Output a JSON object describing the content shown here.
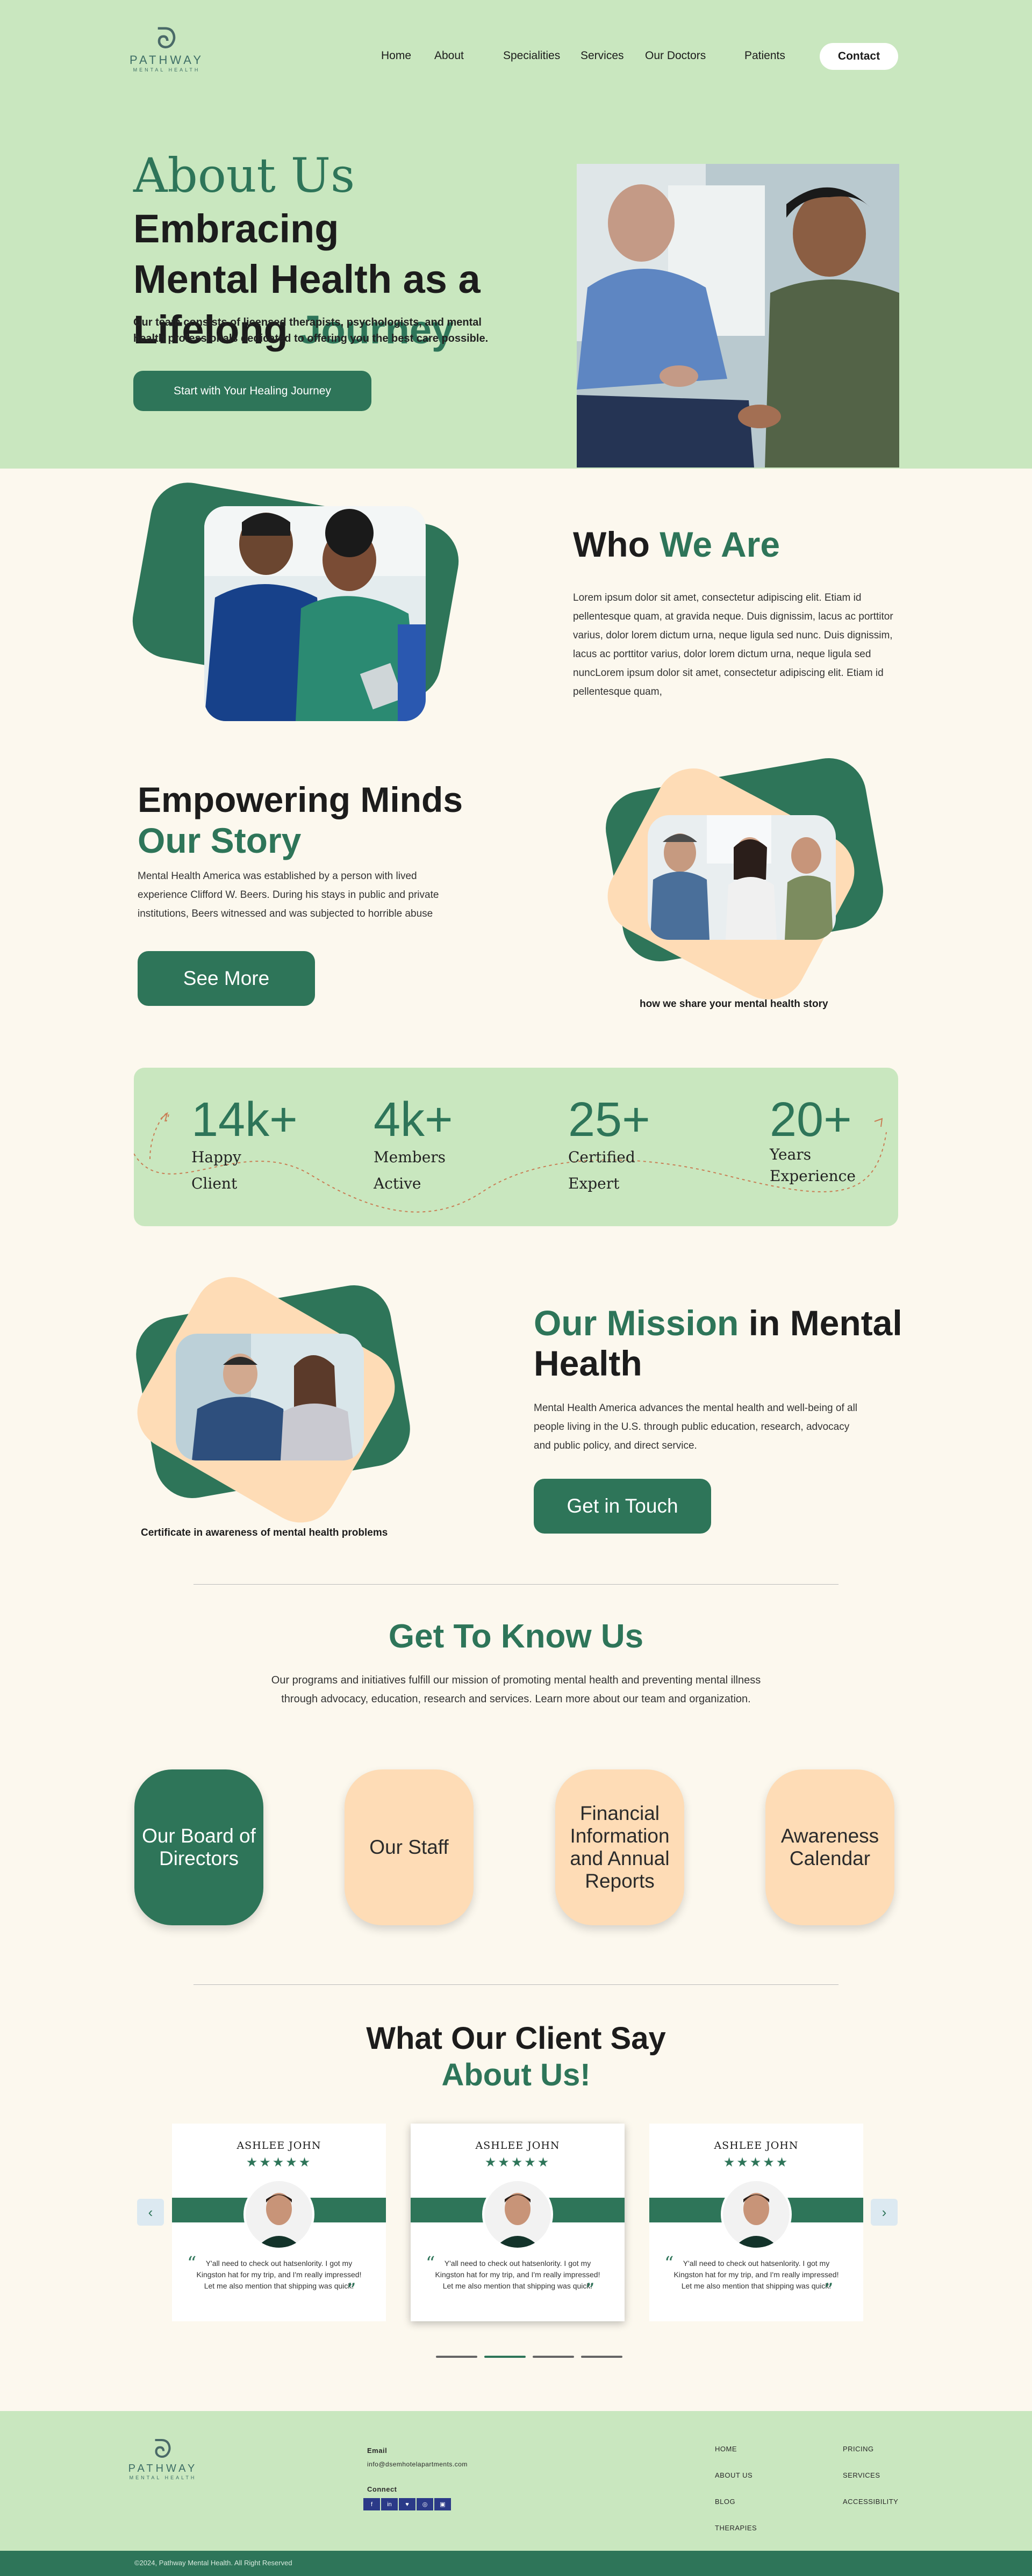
{
  "brand": {
    "name": "PATHWAY",
    "tagline": "MENTAL HEALTH",
    "mark": "ᘐ"
  },
  "nav": {
    "items": [
      "Home",
      "About",
      "Specialities",
      "Services",
      "Our Doctors",
      "Patients"
    ],
    "contact": "Contact"
  },
  "hero": {
    "title_about": "About Us",
    "title_line1": "Embracing",
    "title_line2": "Mental Health as a",
    "title_line3_a": "Lifelong",
    "title_line3_b": "Journey",
    "description": "Our team consists of licensed therapists, psychologists, and mental health professionals dedicated to offering you the best care possible.",
    "cta": "Start with Your Healing Journey"
  },
  "who": {
    "title_a": "Who",
    "title_b": "We Are",
    "body": "Lorem ipsum dolor sit amet, consectetur adipiscing elit. Etiam id pellentesque quam, at gravida neque. Duis dignissim, lacus ac porttitor varius, dolor lorem dictum urna, neque ligula sed nunc. Duis dignissim, lacus ac porttitor varius, dolor lorem dictum urna, neque ligula sed nuncLorem ipsum dolor sit amet, consectetur adipiscing elit. Etiam id pellentesque quam,"
  },
  "story": {
    "title_a": "Empowering Minds",
    "title_b": "Our Story",
    "body": "Mental Health America was established by a person with lived experience Clifford W. Beers. During his stays in public and private institutions, Beers witnessed and was subjected to horrible abuse",
    "cta": "See More",
    "caption": "how we share your mental health story"
  },
  "stats": [
    {
      "value": "14k+",
      "label1": "Happy",
      "label2": "Client"
    },
    {
      "value": "4k+",
      "label1": "Members",
      "label2": "Active"
    },
    {
      "value": "25+",
      "label1": "Certified",
      "label2": "Expert"
    },
    {
      "value": "20+",
      "label1": "Years",
      "label2": "Experience"
    }
  ],
  "mission": {
    "title_a": "Our Mission",
    "title_b": "in Mental",
    "title_c": "Health",
    "body": "Mental Health America advances the mental health and well-being of all people living in the U.S. through public education, research, advocacy and public policy, and direct service.",
    "cta": "Get in Touch",
    "caption": "Certificate in awareness of mental health problems"
  },
  "know": {
    "title": "Get To Know Us",
    "body": "Our programs and initiatives fulfill our mission of promoting mental health and preventing mental illness through advocacy, education, research and services. Learn more about our team and organization.",
    "cards": [
      "Our Board of Directors",
      "Our Staff",
      "Financial Information and Annual Reports",
      "Awareness Calendar"
    ]
  },
  "clients": {
    "title_a": "What Our Client Say",
    "title_b": "About Us!",
    "testimonials": [
      {
        "name": "ASHLEE JOHN",
        "stars": "★★★★★",
        "quote": "Y'all need to check out hatsenlority. I got my Kingston hat for my trip, and I'm really impressed! Let me also mention that shipping was quick!"
      },
      {
        "name": "ASHLEE JOHN",
        "stars": "★★★★★",
        "quote": "Y'all need to check out hatsenlority. I got my Kingston hat for my trip, and I'm really impressed! Let me also mention that shipping was quick!"
      },
      {
        "name": "ASHLEE JOHN",
        "stars": "★★★★★",
        "quote": "Y'all need to check out hatsenlority. I got my Kingston hat for my trip, and I'm really impressed! Let me also mention that shipping was quick!"
      }
    ],
    "prev": "‹",
    "next": "›"
  },
  "footer": {
    "email_label": "Email",
    "email": "info@dsemhotelapartments.com",
    "connect_label": "Connect",
    "social": [
      "f",
      "in",
      "♥",
      "◎",
      "▣"
    ],
    "links_col1": [
      "HOME",
      "ABOUT US",
      "BLOG",
      "THERAPIES"
    ],
    "links_col2": [
      "PRICING",
      "SERVICES",
      "ACCESSIBILITY"
    ],
    "copyright": "©2024, Pathway Mental Health. All Right Reserved",
    "colors": {
      "primary": "#2e7559",
      "mint": "#c9e7bf",
      "peach": "#fedcb6",
      "cream": "#fcf8ee"
    }
  }
}
